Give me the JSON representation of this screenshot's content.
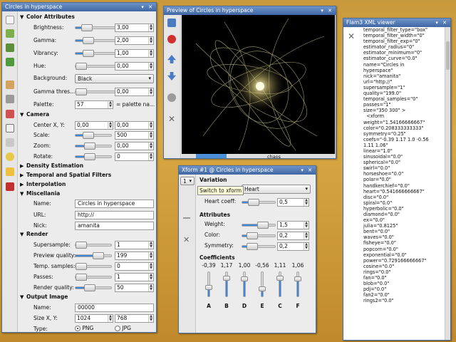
{
  "main": {
    "title": "Circles in hyperspace",
    "sections": {
      "color": "Color Attributes",
      "camera": "Camera",
      "density": "Density Estimation",
      "filters": "Temporal and Spatial Filters",
      "interp": "Interpolation",
      "misc": "Miscellania",
      "render": "Render",
      "output": "Output Image"
    },
    "color": {
      "brightness": {
        "label": "Brightness:",
        "value": "3,00",
        "level": 0.15
      },
      "gamma": {
        "label": "Gamma:",
        "value": "2,00",
        "level": 0.2
      },
      "vibrancy": {
        "label": "Vibrancy:",
        "value": "1,00",
        "level": 0.2
      },
      "hue": {
        "label": "Hue:",
        "value": "0,00",
        "level": 0.0
      },
      "background": {
        "label": "Background:",
        "value": "Black"
      },
      "gamma_thresh": {
        "label": "Gamma thres...",
        "value": "0,00",
        "level": 0.0
      },
      "palette": {
        "label": "Palette:",
        "value": "57",
        "note": "= palette na..."
      }
    },
    "camera": {
      "center": {
        "label": "Center X, Y:",
        "x": "0,00",
        "y": "0,00"
      },
      "scale": {
        "label": "Scale:",
        "value": "500",
        "level": 0.3
      },
      "zoom": {
        "label": "Zoom:",
        "value": "0,00",
        "level": 0.35
      },
      "rotate": {
        "label": "Rotate:",
        "value": "0",
        "level": 0.35
      }
    },
    "misc": {
      "name": {
        "label": "Name:",
        "value": "Circles in hyperspace"
      },
      "url": {
        "label": "URL:",
        "value": "http://"
      },
      "nick": {
        "label": "Nick:",
        "value": "amanita"
      }
    },
    "render": {
      "supersample": {
        "label": "Supersample:",
        "value": "1",
        "level": 0.0
      },
      "preview_quality": {
        "label": "Preview quality:",
        "value": "199",
        "level": 0.7
      },
      "temp_samples": {
        "label": "Temp. samples:",
        "value": "0",
        "level": 0.0
      },
      "passes": {
        "label": "Passes:",
        "value": "1",
        "level": 0.0
      },
      "render_quality": {
        "label": "Render quality:",
        "value": "50",
        "level": 0.35
      }
    },
    "output": {
      "name": {
        "label": "Name:",
        "value": "00000"
      },
      "size": {
        "label": "Size X, Y:",
        "x": "1024",
        "y": "768"
      },
      "type": {
        "label": "Type:",
        "png": "PNG",
        "jpg": "JPG",
        "selected": "PNG"
      }
    }
  },
  "preview": {
    "title": "Preview of Circles in hyperspace",
    "status_text": "chaos",
    "progress": 0.2
  },
  "xform": {
    "title": "Xform #1 @ Circles in hyperspace",
    "index": "1",
    "tooltip": "Switch to xform",
    "variation_title": "Variation",
    "variation_value": "Heart",
    "heart_coeff": {
      "label": "Heart coeff:",
      "value": "0,5"
    },
    "attributes_title": "Attributes",
    "weight": {
      "label": "Weight:",
      "value": "1,5",
      "level": 0.7
    },
    "color": {
      "label": "Color:",
      "value": "0,2",
      "level": 0.2
    },
    "symmetry": {
      "label": "Symmetry:",
      "value": "0,2",
      "level": 0.2
    },
    "coefficients_title": "Coefficients",
    "coefficients": [
      {
        "name": "A",
        "value": "-0,39",
        "level": 0.4
      },
      {
        "name": "B",
        "value": "1,17",
        "level": 0.85
      },
      {
        "name": "D",
        "value": "1,00",
        "level": 0.8
      },
      {
        "name": "E",
        "value": "-0,56",
        "level": 0.35
      },
      {
        "name": "C",
        "value": "1,11",
        "level": 0.85
      },
      {
        "name": "F",
        "value": "1,06",
        "level": 0.8
      }
    ]
  },
  "viewer": {
    "title": "Flam3 XML viewer",
    "lines": [
      "temporal_filter_type=\"box\"",
      "temporal_filter_width=\"0\"",
      "temporal_filter_exp=\"0\"",
      "estimator_radius=\"0\"",
      "estimator_minimum=\"0\"",
      "estimator_curve=\"0.0\"",
      "name=\"Circles in",
      "hyperspace\"",
      "nick=\"amanita\"",
      "url=\"http://\"",
      "supersample=\"1\"",
      "quality=\"199.0\"",
      "temporal_samples=\"0\"",
      "passes=\"1\"",
      "size=\"350 300\" >",
      "  <xform",
      "weight=\"1.54166666667\"",
      "color=\"0.208333333333\"",
      "symmetry=\"0.25\"",
      "coefs=\"-0.39 1.17 1.0 -0.56",
      "1.11 1.06\"",
      "linear=\"1.0\"",
      "sinusoidal=\"0.0\"",
      "spherical=\"0.0\"",
      "swirl=\"0.0\"",
      "horseshoe=\"0.0\"",
      "polar=\"0.0\"",
      "handkerchief=\"0.0\"",
      "heart=\"0.541666666667\"",
      "disc=\"0.0\"",
      "spiral=\"0.0\"",
      "hyperbolic=\"0.0\"",
      "diamond=\"0.0\"",
      "ex=\"0.0\"",
      "julia=\"0.8125\"",
      "bent=\"0.0\"",
      "waves=\"0.0\"",
      "fisheye=\"0.0\"",
      "popcorn=\"0.0\"",
      "exponential=\"0.0\"",
      "power=\"0.729166666667\"",
      "cosine=\"0.0\"",
      "rings=\"0.0\"",
      "fan=\"0.0\"",
      "blob=\"0.0\"",
      "pdj=\"0.0\"",
      "fan2=\"0.0\"",
      "rings2=\"0.0\""
    ]
  },
  "colors": {
    "titlebar": "#4f78b4",
    "accent": "#3d86d8",
    "desktop": "#d0a040"
  }
}
